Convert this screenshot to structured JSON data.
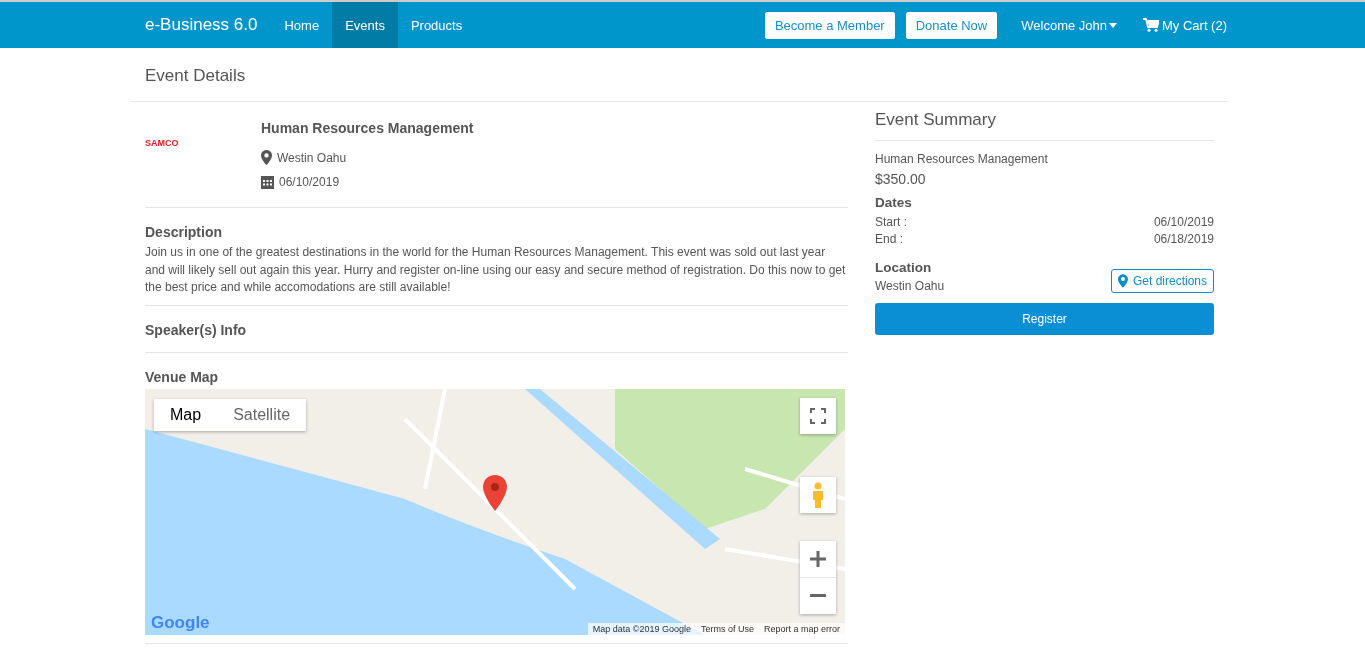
{
  "navbar": {
    "brand": "e-Business 6.0",
    "links": [
      {
        "label": "Home",
        "selected": false
      },
      {
        "label": "Events",
        "selected": true
      },
      {
        "label": "Products",
        "selected": false
      }
    ],
    "buttons": [
      "Become a Member",
      "Donate Now"
    ],
    "user_menu": "Welcome John",
    "cart": "My Cart (2)"
  },
  "page_title": "Event Details",
  "event": {
    "logo": "SAMCO",
    "title": "Human Resources Management",
    "location": "Westin Oahu",
    "date": "06/10/2019"
  },
  "description": {
    "heading": "Description",
    "text": "Join us in one of the greatest destinations in the world for the Human Resources Management. This event was sold out last year and will likely sell out again this year. Hurry and register on-line using our easy and secure method of registration. Do this now to get the best price and while accomodations are still available!"
  },
  "speakers": {
    "heading": "Speaker(s) Info"
  },
  "venue_map": {
    "heading": "Venue Map",
    "map_types": [
      {
        "label": "Map",
        "selected": true
      },
      {
        "label": "Satellite",
        "selected": false
      }
    ],
    "logo": "Google",
    "footer": [
      "Map data ©2019 Google",
      "Terms of Use",
      "Report a map error"
    ]
  },
  "summary": {
    "heading": "Event Summary",
    "event_name": "Human Resources Management",
    "price": "$350.00",
    "dates_heading": "Dates",
    "dates": [
      {
        "label": "Start :",
        "value": "06/10/2019"
      },
      {
        "label": "End :",
        "value": "06/18/2019"
      }
    ],
    "location_heading": "Location",
    "location": "Westin Oahu",
    "directions_button": "Get directions",
    "register_button": "Register"
  }
}
